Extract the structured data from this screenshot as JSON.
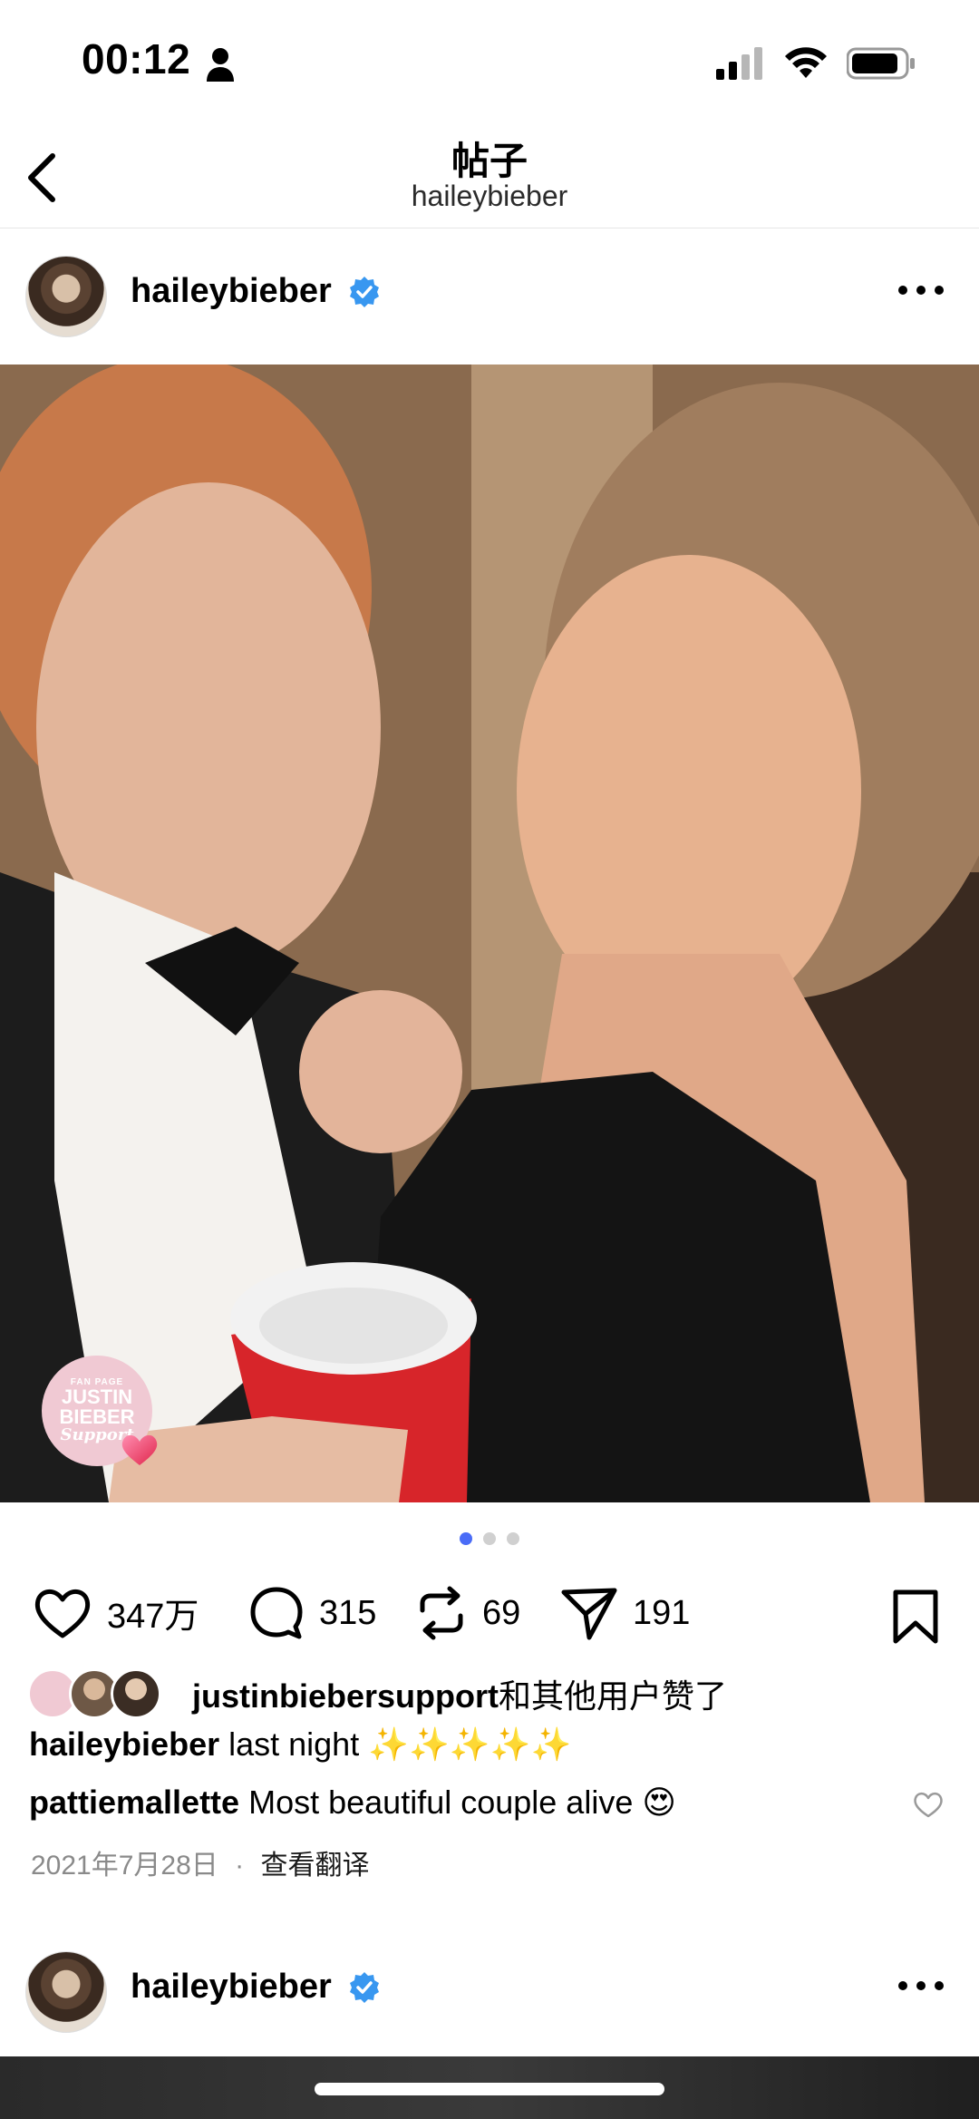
{
  "status_bar": {
    "time": "00:12"
  },
  "nav": {
    "title": "帖子",
    "subtitle": "haileybieber"
  },
  "post": {
    "username": "haileybieber",
    "verified": true,
    "photo_badge": {
      "line1": "FAN PAGE",
      "line2": "JUSTIN",
      "line3": "BIEBER",
      "line4": "Support"
    },
    "carousel": {
      "count": 3,
      "active_index": 0
    },
    "actions": {
      "likes": "347万",
      "comments": "315",
      "reposts": "69",
      "shares": "191"
    },
    "liked_by": {
      "username": "justinbiebersupport",
      "suffix": "和其他用户赞了"
    },
    "caption": {
      "username": "haileybieber",
      "text": "last night ✨✨✨✨✨"
    },
    "top_comment": {
      "username": "pattiemallette",
      "text": "Most beautiful couple alive 😍"
    },
    "date": "2021年7月28日",
    "separator": "·",
    "translate": "查看翻译"
  },
  "next_post": {
    "username": "haileybieber"
  },
  "colors": {
    "accent_blue": "#4a6cf7",
    "verified_blue": "#3897f0",
    "muted_text": "#8a8a8a"
  }
}
